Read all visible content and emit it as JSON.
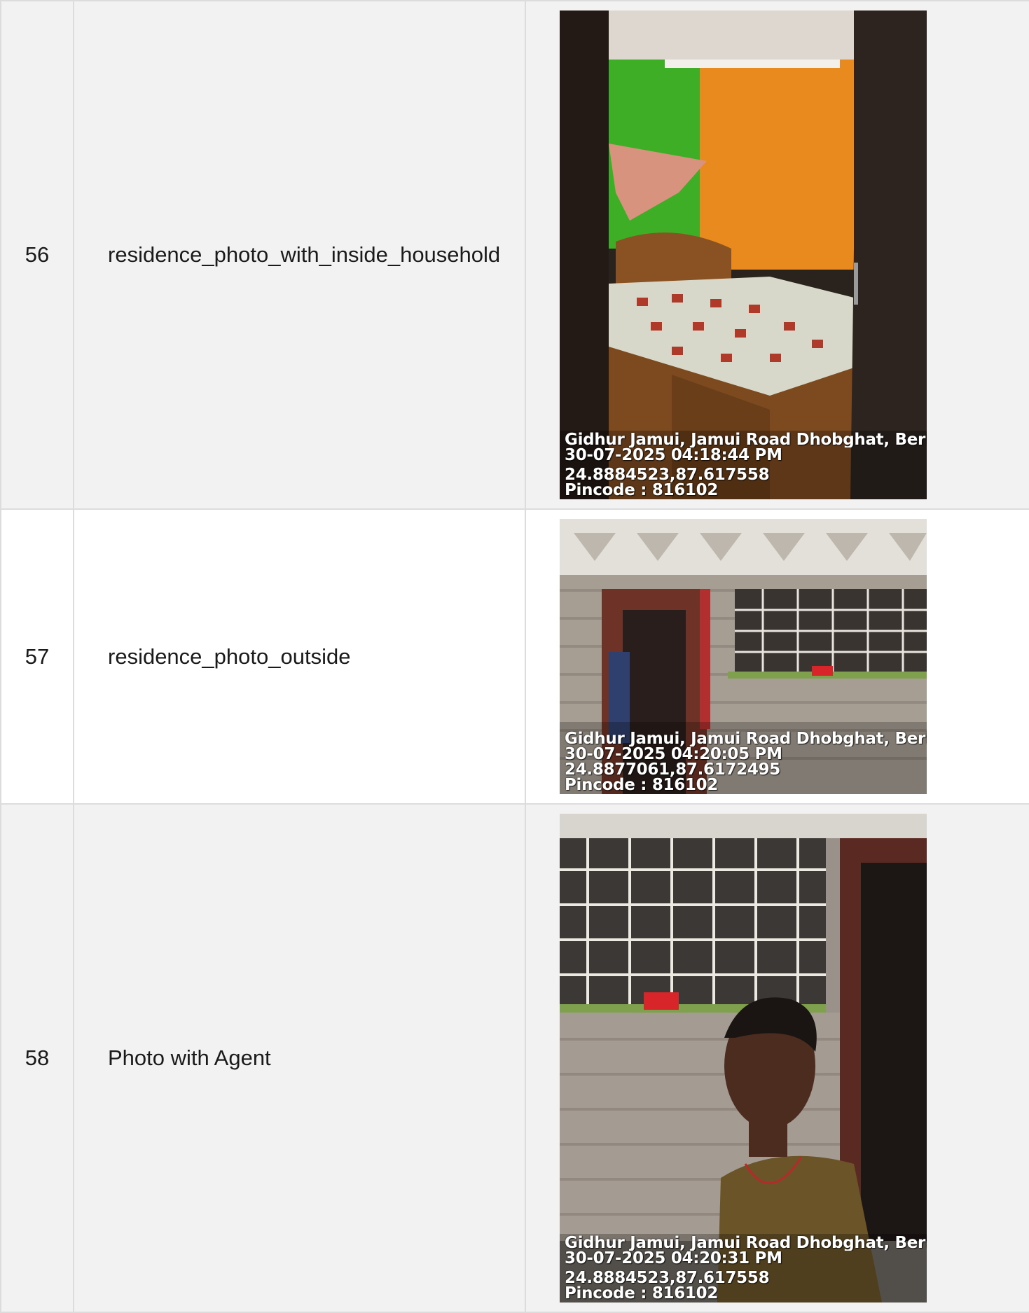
{
  "rows": [
    {
      "number": "56",
      "label": "residence_photo_with_inside_household",
      "photo": {
        "subject": "bedroom interior",
        "stamp": {
          "address": "Gidhur Jamui, Jamui Road Dhobghat, Berhai",
          "datetime": "30-07-2025 04:18:44 PM",
          "coords": "24.8884523,87.617558",
          "pincode": "Pincode : 816102"
        }
      }
    },
    {
      "number": "57",
      "label": "residence_photo_outside",
      "photo": {
        "subject": "house exterior",
        "stamp": {
          "address": "Gidhur Jamui, Jamui Road Dhobghat, Berhai",
          "datetime": "30-07-2025 04:20:05 PM",
          "coords": "24.8877061,87.6172495",
          "pincode": "Pincode : 816102"
        }
      }
    },
    {
      "number": "58",
      "label": "Photo with Agent",
      "photo": {
        "subject": "selfie in front of house",
        "stamp": {
          "address": "Gidhur Jamui, Jamui Road Dhobghat, Berhai",
          "datetime": "30-07-2025 04:20:31 PM",
          "coords": "24.8884523,87.617558",
          "pincode": "Pincode : 816102"
        }
      }
    }
  ],
  "colors": {
    "row_shaded": "#f2f2f2",
    "row_plain": "#ffffff",
    "border": "#dcdcdc",
    "text": "#1a1a1a"
  }
}
